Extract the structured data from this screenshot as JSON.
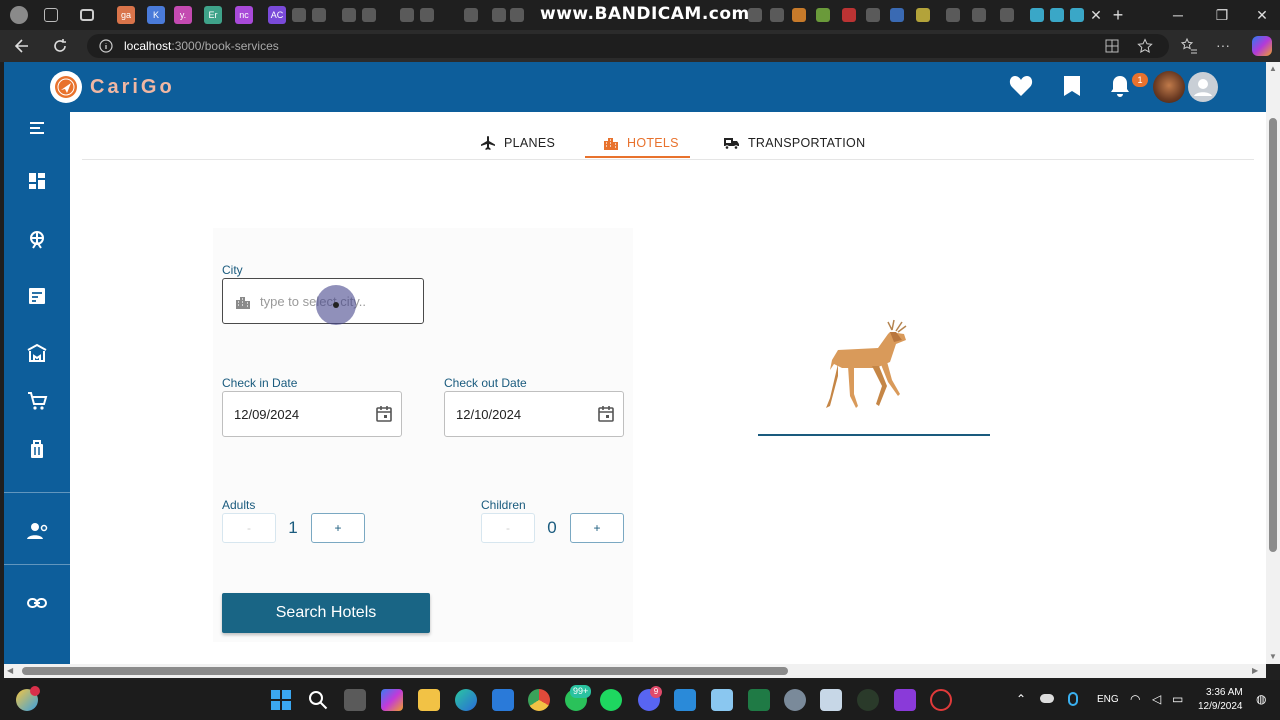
{
  "browser": {
    "tab_favicons": [
      "ga",
      "K",
      "y.",
      "Er",
      "nc",
      "AC"
    ],
    "watermark": "www.BANDICAM.com",
    "url_host": "localhost",
    "url_path": ":3000/book-services"
  },
  "app": {
    "brand": "CariGo",
    "notification_count": "1",
    "colors": {
      "primary": "#0d5e9b",
      "accent": "#e8722d",
      "label": "#1a5b7e",
      "button": "#196585"
    }
  },
  "tabs": [
    {
      "label": "PLANES",
      "icon": "airplane-icon"
    },
    {
      "label": "HOTELS",
      "icon": "building-icon",
      "active": true
    },
    {
      "label": "TRANSPORTATION",
      "icon": "car-icon"
    }
  ],
  "form": {
    "city_label": "City",
    "city_placeholder": "type to select city..",
    "checkin_label": "Check in Date",
    "checkin_value": "12/09/2024",
    "checkout_label": "Check out Date",
    "checkout_value": "12/10/2024",
    "adults_label": "Adults",
    "adults_value": "1",
    "children_label": "Children",
    "children_value": "0",
    "minus": "-",
    "plus": "+",
    "submit": "Search Hotels"
  },
  "taskbar": {
    "language": "ENG",
    "time": "3:36 AM",
    "date": "12/9/2024",
    "whatsapp_badge": "99+",
    "discord_badge": "9"
  }
}
